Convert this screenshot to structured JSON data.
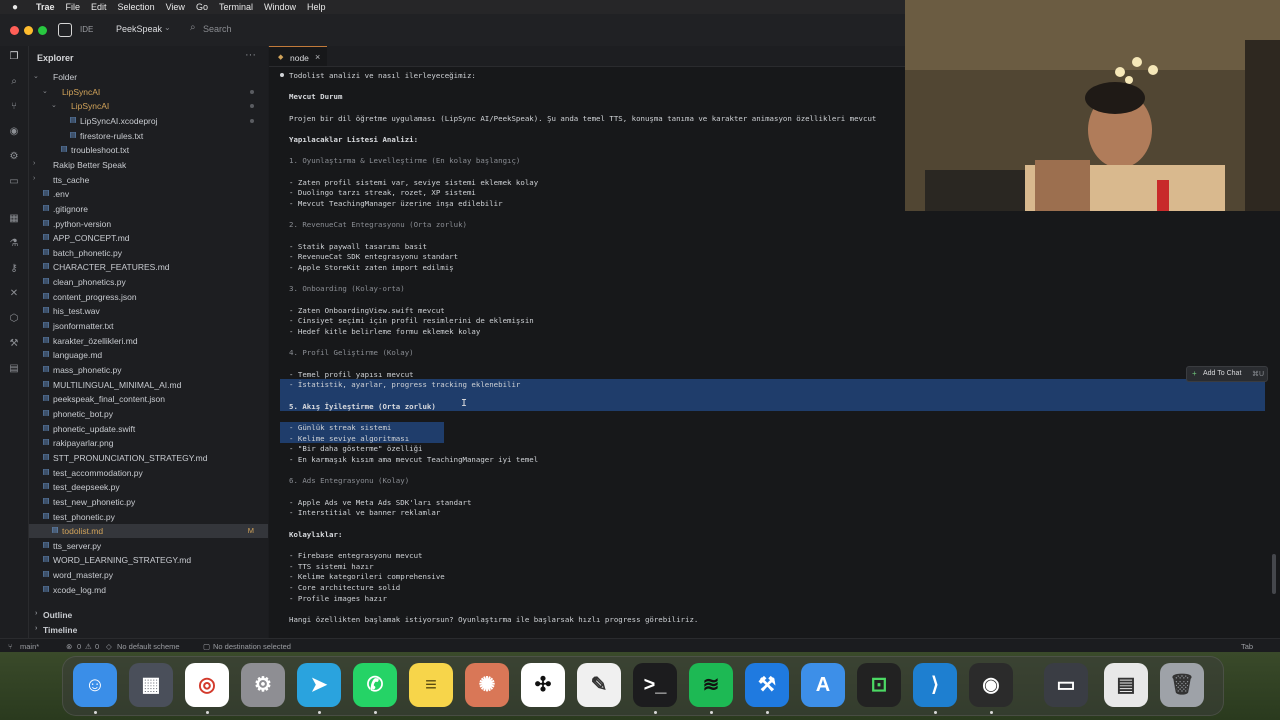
{
  "menubar": {
    "apple_icon": "apple-icon",
    "items": [
      "Trae",
      "File",
      "Edit",
      "Selection",
      "View",
      "Go",
      "Terminal",
      "Window",
      "Help"
    ]
  },
  "titlebar": {
    "ide_label": "IDE",
    "project": "PeekSpeak",
    "search_placeholder": "Search"
  },
  "sidebar": {
    "title": "Explorer",
    "rows": [
      {
        "label": "Folder",
        "type": "folder-open"
      },
      {
        "label": "LipSyncAI",
        "type": "folder-open",
        "accent": true
      },
      {
        "label": "LipSyncAI",
        "type": "folder-open",
        "accent": true
      },
      {
        "label": "LipSyncAI.xcodeproj",
        "type": "file"
      },
      {
        "label": "firestore-rules.txt",
        "type": "file"
      },
      {
        "label": "troubleshoot.txt",
        "type": "file"
      },
      {
        "label": "Rakip Better Speak",
        "type": "folder"
      },
      {
        "label": "tts_cache",
        "type": "folder"
      },
      {
        "label": ".env",
        "type": "file"
      },
      {
        "label": ".gitignore",
        "type": "file"
      },
      {
        "label": ".python-version",
        "type": "file"
      },
      {
        "label": "APP_CONCEPT.md",
        "type": "file"
      },
      {
        "label": "batch_phonetic.py",
        "type": "file"
      },
      {
        "label": "CHARACTER_FEATURES.md",
        "type": "file"
      },
      {
        "label": "clean_phonetics.py",
        "type": "file"
      },
      {
        "label": "content_progress.json",
        "type": "file"
      },
      {
        "label": "his_test.wav",
        "type": "file"
      },
      {
        "label": "jsonformatter.txt",
        "type": "file"
      },
      {
        "label": "karakter_özellikleri.md",
        "type": "file"
      },
      {
        "label": "language.md",
        "type": "file"
      },
      {
        "label": "mass_phonetic.py",
        "type": "file"
      },
      {
        "label": "MULTILINGUAL_MINIMAL_AI.md",
        "type": "file"
      },
      {
        "label": "peekspeak_final_content.json",
        "type": "file"
      },
      {
        "label": "phonetic_bot.py",
        "type": "file"
      },
      {
        "label": "phonetic_update.swift",
        "type": "file"
      },
      {
        "label": "rakipayarlar.png",
        "type": "file"
      },
      {
        "label": "STT_PRONUNCIATION_STRATEGY.md",
        "type": "file"
      },
      {
        "label": "test_accommodation.py",
        "type": "file"
      },
      {
        "label": "test_deepseek.py",
        "type": "file"
      },
      {
        "label": "test_new_phonetic.py",
        "type": "file"
      },
      {
        "label": "test_phonetic.py",
        "type": "file"
      },
      {
        "label": "todolist.md",
        "type": "file",
        "accent": true,
        "modified": "M"
      },
      {
        "label": "tts_server.py",
        "type": "file"
      },
      {
        "label": "WORD_LEARNING_STRATEGY.md",
        "type": "file"
      },
      {
        "label": "word_master.py",
        "type": "file"
      },
      {
        "label": "xcode_log.md",
        "type": "file"
      }
    ],
    "outline": "Outline",
    "timeline": "Timeline"
  },
  "editor": {
    "tab_label": "node",
    "lines": [
      "Todolist analizi ve nasıl ilerleyeceğimiz:",
      "",
      "Mevcut Durum",
      "",
      "Projen bir dil öğretme uygulaması (LipSync AI/PeekSpeak). Şu anda temel TTS, konuşma tanıma ve karakter animasyon özellikleri mevcut",
      "",
      "Yapılacaklar Listesi Analizi:",
      "",
      "1. Oyunlaştırma & Levelleştirme (En kolay başlangıç)",
      "",
      "- Zaten profil sistemi var, seviye sistemi eklemek kolay",
      "- Duolingo tarzı streak, rozet, XP sistemi",
      "- Mevcut TeachingManager üzerine inşa edilebilir",
      "",
      "2. RevenueCat Entegrasyonu (Orta zorluk)",
      "",
      "- Statik paywall tasarımı basit",
      "- RevenueCat SDK entegrasyonu standart",
      "- Apple StoreKit zaten import edilmiş",
      "",
      "3. Onboarding (Kolay-orta)",
      "",
      "- Zaten OnboardingView.swift mevcut",
      "- Cinsiyet seçimi için profil resimlerini de eklemişsin",
      "- Hedef kitle belirleme formu eklemek kolay",
      "",
      "4. Profil Geliştirme (Kolay)",
      "",
      "- Temel profil yapısı mevcut",
      "- İstatistik, ayarlar, progress tracking eklenebilir",
      "",
      "5. Akış İyileştirme (Orta zorluk)",
      "",
      "- Günlük streak sistemi",
      "- Kelime seviye algoritması",
      "- \"Bir daha gösterme\" özelliği",
      "- En karmaşık kısım ama mevcut TeachingManager iyi temel",
      "",
      "6. Ads Entegrasyonu (Kolay)",
      "",
      "- Apple Ads ve Meta Ads SDK'ları standart",
      "- Interstitial ve banner reklamlar",
      "",
      "Kolaylıklar:",
      "",
      "- Firebase entegrasyonu mevcut",
      "- TTS sistemi hazır",
      "- Kelime kategorileri comprehensive",
      "- Core architecture solid",
      "- Profile images hazır",
      "",
      "Hangi özellikten başlamak istiyorsun? Oyunlaştırma ile başlarsak hızlı progress görebiliriz."
    ],
    "add_to_chat": {
      "label": "Add To Chat",
      "shortcut": "⌘U"
    }
  },
  "statusbar": {
    "branch": "main*",
    "errors": "0",
    "warnings": "0",
    "scheme": "No default scheme",
    "destination": "No destination selected",
    "tab": "Tab"
  },
  "colors": {
    "accent_orange": "#d1a35a",
    "selection": "#1f3d6b",
    "keyword_blue": "#5c9fd6"
  },
  "dock": {
    "apps": [
      "finder-icon",
      "launchpad-icon",
      "chrome-icon",
      "system-settings-icon",
      "telegram-icon",
      "whatsapp-icon",
      "notes-icon",
      "claude-icon",
      "chatgpt-icon",
      "textedit-icon",
      "terminal-icon",
      "spotify-icon",
      "xcode-icon",
      "instruments-icon",
      "screen-app-icon",
      "vscode-icon",
      "obs-icon",
      "screenshot-icon",
      "preview-icon",
      "trash-icon"
    ]
  }
}
